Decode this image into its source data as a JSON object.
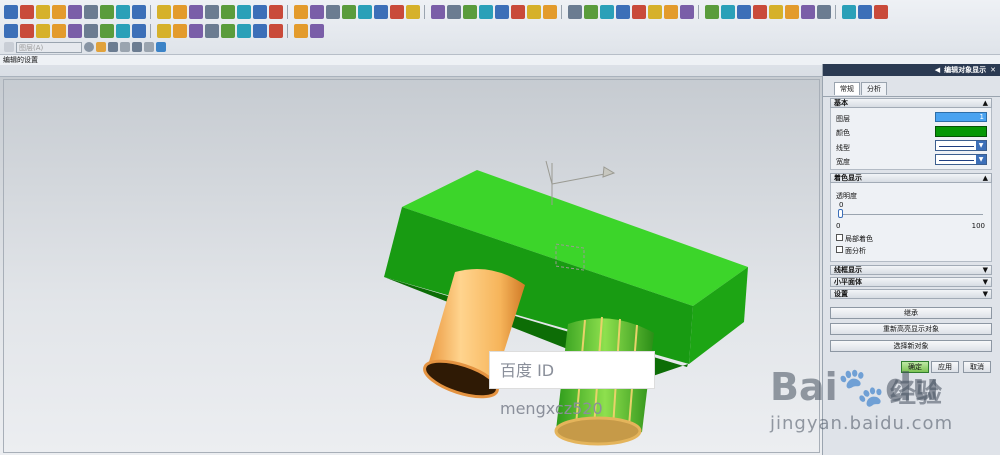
{
  "layer_combo": {
    "value": "图层(A)"
  },
  "status": {
    "text": "编辑的设置"
  },
  "panel": {
    "title": "编辑对象显示",
    "tabs": [
      {
        "label": "常规"
      },
      {
        "label": "分析"
      }
    ],
    "basic": {
      "header": "基本",
      "layer_label": "图层",
      "layer_value": "1",
      "color_label": "颜色",
      "color_value": "#069806",
      "linetype_label": "线型",
      "width_label": "宽度"
    },
    "shading": {
      "header": "着色显示",
      "transparency_label": "透明度",
      "slider_value": "0",
      "slider_min": "0",
      "slider_max": "100",
      "local_shading_label": "局部着色",
      "face_analysis_label": "面分析"
    },
    "wireframe": {
      "header": "线框显示"
    },
    "widget": {
      "header": "小平面体"
    },
    "settings": {
      "header": "设置"
    },
    "buttons": {
      "inherit": "继承",
      "rehighlight": "重新高亮显示对象",
      "select_new": "选择新对象"
    },
    "footer": {
      "ok": "确定",
      "apply": "应用",
      "cancel": "取消"
    }
  },
  "watermark": {
    "text": "百度 ID mengxcz520"
  },
  "baidu_logo": {
    "top": "Bai",
    "du": "du",
    "jingyan": "经验",
    "url": "jingyan.baidu.com"
  }
}
